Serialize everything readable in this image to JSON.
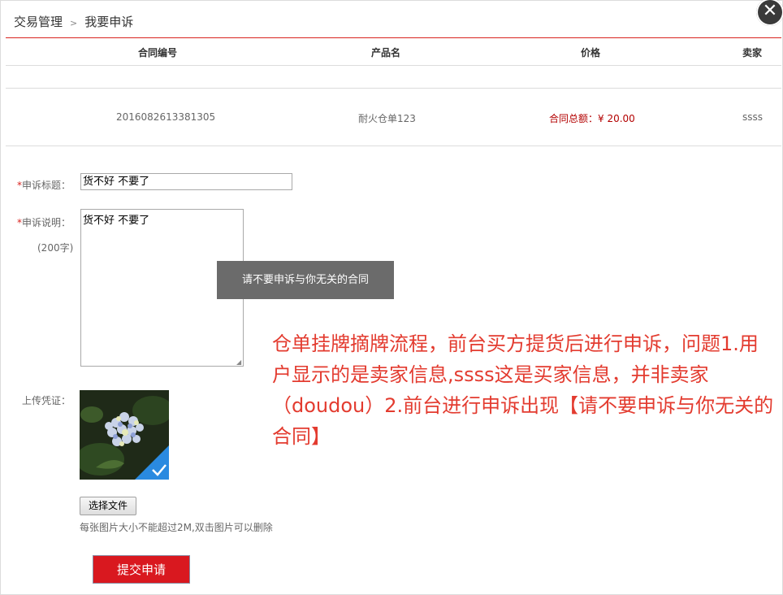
{
  "breadcrumb": {
    "parent": "交易管理",
    "separator": ">",
    "current": "我要申诉"
  },
  "close_label": "✕",
  "table": {
    "headers": [
      "合同编号",
      "产品名",
      "价格",
      "卖家"
    ],
    "row": {
      "contract_no": "2016082613381305",
      "product": "耐火仓单123",
      "price_label": "合同总额：",
      "price_value": "¥ 20.00",
      "seller": "ssss"
    }
  },
  "form": {
    "required_mark": "*",
    "title_label": "申诉标题：",
    "title_value": "货不好 不要了",
    "desc_label": "申诉说明：",
    "desc_hint": "(200字)",
    "desc_value": "货不好 不要了",
    "upload_label": "上传凭证：",
    "choose_file": "选择文件",
    "upload_hint": "每张图片大小不能超过2M,双击图片可以删除",
    "submit": "提交申请"
  },
  "toast": "请不要申诉与你无关的合同",
  "annotation": "仓单挂牌摘牌流程，前台买方提货后进行申诉，问题1.用户显示的是卖家信息,ssss这是买家信息，并非卖家（doudou）2.前台进行申诉出现【请不要申诉与你无关的合同】",
  "colors": {
    "accent_red": "#d9231f",
    "submit_red": "#d9181f",
    "note_red": "#e33b2f",
    "toast_bg": "#6b6b6b"
  },
  "icons": {
    "close": "close-icon",
    "check": "checkmark-icon"
  }
}
